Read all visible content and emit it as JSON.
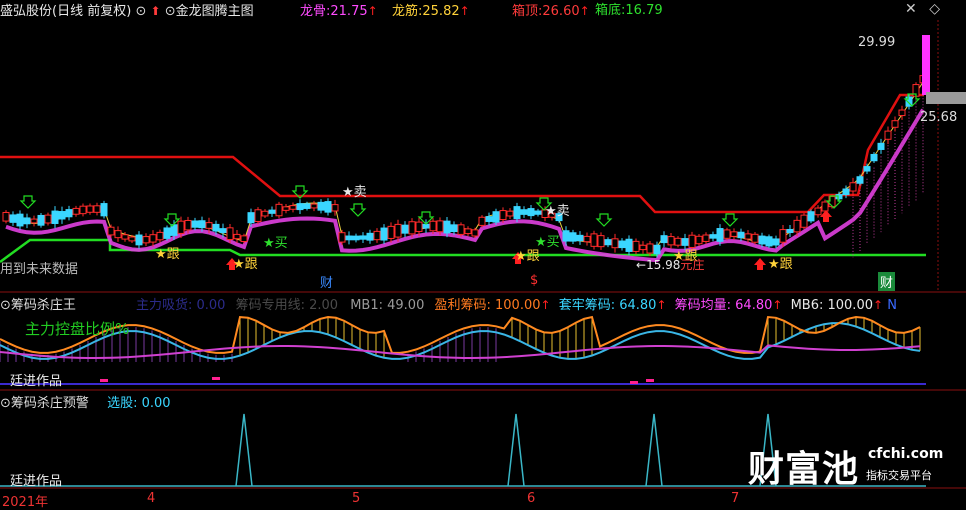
{
  "header": {
    "stock": "盛弘股份",
    "period_mode": "(日线 前复权)",
    "indicator_name": "金龙图腾主图",
    "long_gu_label": "龙骨:",
    "long_gu_value": "21.75",
    "long_jin_label": "龙筋:",
    "long_jin_value": "25.82",
    "box_top_label": "箱顶:",
    "box_top_value": "26.60",
    "box_bottom_label": "箱底:",
    "box_bottom_value": "16.79",
    "up_arrow": "↑"
  },
  "main": {
    "price_high": "29.99",
    "price_low": "25.68",
    "future_data_note": "用到未来数据",
    "signals": {
      "buy": "买",
      "sell": "卖",
      "follow": "跟",
      "star": "★",
      "finance_tag": "财",
      "reduce_tag": "减",
      "s_tag": "$",
      "low_price": "15.98",
      "yuan_tag": "元",
      "zhuang_tag": "庄"
    }
  },
  "panel1": {
    "title": "筹码杀庄王",
    "main_chip_label": "主力吸货: 0.00",
    "chip_line_label": "筹码专用线: 2.00",
    "mb1": "MB1: 49.00",
    "profit_label": "盈利筹码: 100.00",
    "trapped_label": "套牢筹码: 64.80",
    "avg_label": "筹码均量: 64.80",
    "mb6": "MB6: 100.00",
    "truncated_n": "N",
    "overlay_text": "主力控盘比例%",
    "author": "廷进作品"
  },
  "panel2": {
    "title": "筹码杀庄预警",
    "select_label": "选股: 0.00",
    "author": "廷进作品"
  },
  "time_axis": {
    "year": "2021年",
    "months": [
      "4",
      "5",
      "6",
      "7"
    ]
  },
  "watermark": {
    "main": "财富池",
    "url": "cfchi.com",
    "sub": "指标交易平台"
  },
  "colors": {
    "up": "#ff2a2a",
    "down": "#3ad6ff",
    "ma_magenta": "#e040e0",
    "box_top": "#e01010",
    "box_bottom": "#22dd22",
    "ma_yellow": "#e8d040",
    "profit_orange": "#ff8a20",
    "trapped_cyan": "#3ab6e6"
  }
}
